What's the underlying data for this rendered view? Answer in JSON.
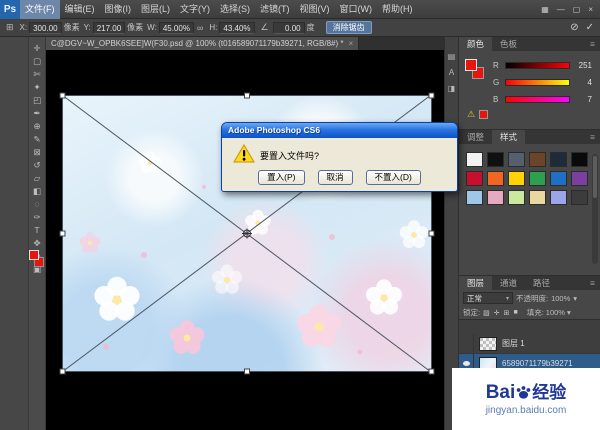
{
  "window": {
    "workspace_icon": "▦",
    "minimize_icon": "—",
    "restore_icon": "▢",
    "close_icon": "×"
  },
  "menubar": {
    "logo": "Ps",
    "items": [
      "文件(F)",
      "编辑(E)",
      "图像(I)",
      "图层(L)",
      "文字(Y)",
      "选择(S)",
      "滤镜(T)",
      "视图(V)",
      "窗口(W)",
      "帮助(H)"
    ]
  },
  "optionsbar": {
    "reference_icon": "⊞",
    "x_label": "X:",
    "x_value": "300.00",
    "x_unit": "像素",
    "y_label": "Y:",
    "y_value": "217.00",
    "y_unit": "像素",
    "w_label": "W:",
    "w_value": "45.00%",
    "link_icon": "∞",
    "h_label": "H:",
    "h_value": "43.40%",
    "angle_icon": "∠",
    "angle_value": "0.00",
    "angle_unit": "度",
    "antialias_label": "消除锯齿",
    "cancel_icon": "⊘",
    "commit_icon": "✓"
  },
  "document_tab": {
    "title": "C@DGV~W_OPBK6SEE]W(F30.psd @ 100% (t016589071179b39271, RGB/8#) *",
    "close_icon": "×"
  },
  "tools": [
    {
      "name": "move",
      "glyph": "✛"
    },
    {
      "name": "marquee",
      "glyph": "▢"
    },
    {
      "name": "lasso",
      "glyph": "✄"
    },
    {
      "name": "quick-selection",
      "glyph": "✦"
    },
    {
      "name": "crop",
      "glyph": "◰"
    },
    {
      "name": "eyedropper",
      "glyph": "✒"
    },
    {
      "name": "healing-brush",
      "glyph": "⊕"
    },
    {
      "name": "brush",
      "glyph": "✎"
    },
    {
      "name": "clone-stamp",
      "glyph": "⊠"
    },
    {
      "name": "history-brush",
      "glyph": "↺"
    },
    {
      "name": "eraser",
      "glyph": "▱"
    },
    {
      "name": "gradient",
      "glyph": "◧"
    },
    {
      "name": "blur",
      "glyph": "◌"
    },
    {
      "name": "pen",
      "glyph": "✑"
    },
    {
      "name": "type",
      "glyph": "T"
    },
    {
      "name": "hand",
      "glyph": "✥"
    }
  ],
  "tools_below": [
    {
      "name": "quick-mask",
      "glyph": "◍"
    },
    {
      "name": "screen-mode",
      "glyph": "▣"
    }
  ],
  "dialog": {
    "title": "Adobe Photoshop CS6",
    "message": "要置入文件吗?",
    "buttons": [
      "置入(P)",
      "取消",
      "不置入(D)"
    ]
  },
  "right_strip": {
    "icons": [
      "▤",
      "A",
      "◨"
    ]
  },
  "color_panel": {
    "tabs": [
      "颜色",
      "色板"
    ],
    "foreground_color": "#e8150d",
    "channels": [
      {
        "label": "R",
        "value": "251"
      },
      {
        "label": "G",
        "value": "4"
      },
      {
        "label": "B",
        "value": "7"
      }
    ],
    "warning_icon": "⚠"
  },
  "styles_panel": {
    "tabs": [
      "调整",
      "样式"
    ],
    "swatches": [
      "#f2f2f2",
      "#101010",
      "#55606c",
      "#6e4428",
      "#1d2b3a",
      "#0a0a0a",
      "#c8102e",
      "#f26522",
      "#ffd400",
      "#2e9e4f",
      "#1f6fc4",
      "#7b3fa0",
      "#9fc8e8",
      "#e8a9c0",
      "#cbe89f",
      "#e8d79f",
      "#9aa6e8",
      "#3c3c3c"
    ]
  },
  "layers_panel": {
    "tabs": [
      "图层",
      "通道",
      "路径"
    ],
    "blend_mode": "正常",
    "opacity_label": "不透明度:",
    "opacity_value": "100%",
    "lock_label": "锁定:",
    "lock_icons": [
      "▨",
      "✛",
      "⊞",
      "■"
    ],
    "fill_label": "填充:",
    "fill_value": "100%",
    "layers": [
      {
        "name": "图层 1"
      },
      {
        "name": "6589071179b39271"
      }
    ]
  },
  "watermark": {
    "brand_prefix": "Bai",
    "brand_suffix": "经验",
    "url": "jingyan.baidu.com"
  },
  "ui": {
    "caret": "▾",
    "panel_menu": "≡"
  }
}
